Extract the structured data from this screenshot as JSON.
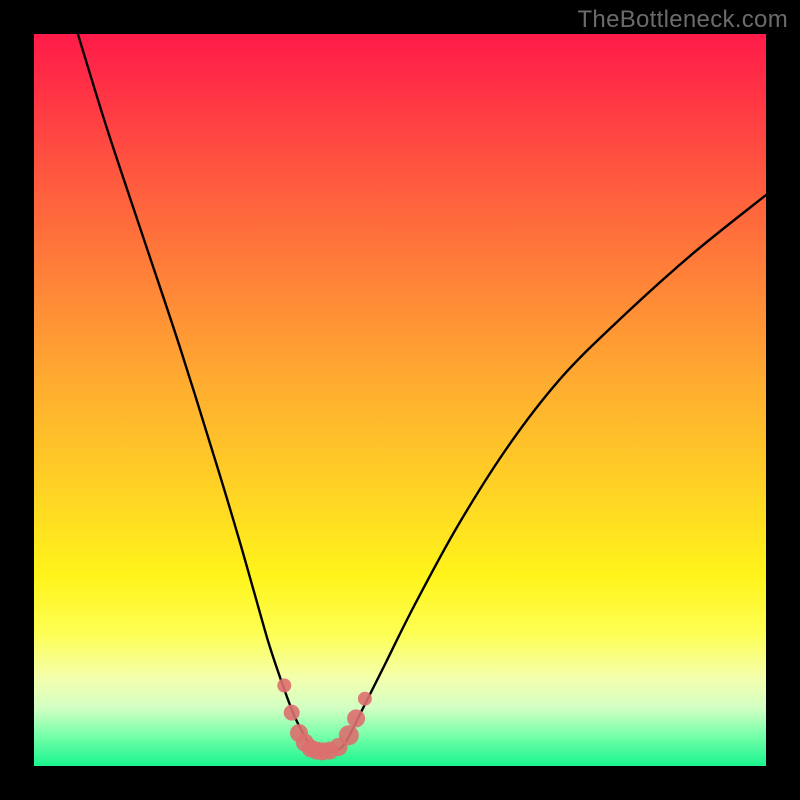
{
  "watermark": "TheBottleneck.com",
  "colors": {
    "frame": "#000000",
    "curve": "#000000",
    "marker": "#dd6f6f",
    "gradient_top": "#ff1b49",
    "gradient_bottom": "#19f48e"
  },
  "chart_data": {
    "type": "line",
    "title": "",
    "xlabel": "",
    "ylabel": "",
    "xlim": [
      0,
      100
    ],
    "ylim": [
      0,
      100
    ],
    "series": [
      {
        "name": "bottleneck-curve",
        "x": [
          6,
          10,
          15,
          20,
          25,
          28,
          30,
          32,
          34,
          35.5,
          37,
          38,
          39,
          40,
          41,
          42,
          43,
          45,
          48,
          52,
          58,
          65,
          72,
          80,
          90,
          100
        ],
        "y": [
          100,
          87,
          72,
          57,
          41,
          31,
          24,
          17,
          11,
          7,
          4,
          2.5,
          2,
          2,
          2,
          2.5,
          4,
          8,
          14,
          22,
          33,
          44,
          53,
          61,
          70,
          78
        ]
      }
    ],
    "markers": {
      "name": "highlight-points",
      "x": [
        34.2,
        35.2,
        36.2,
        37.0,
        37.8,
        38.6,
        39.4,
        40.4,
        41.6,
        43.0,
        44.0,
        45.2
      ],
      "y": [
        11.0,
        7.3,
        4.5,
        3.2,
        2.4,
        2.1,
        2.0,
        2.1,
        2.6,
        4.2,
        6.5,
        9.2
      ],
      "r": [
        7,
        8,
        9,
        9,
        9,
        9,
        9,
        9,
        9,
        10,
        9,
        7
      ]
    }
  }
}
